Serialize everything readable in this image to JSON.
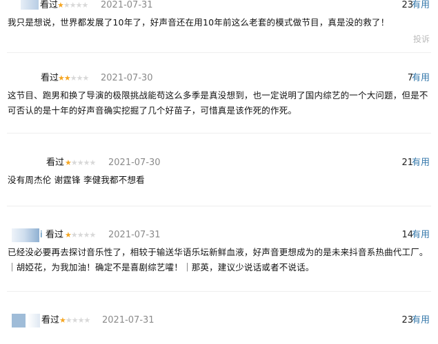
{
  "comments": [
    {
      "user": "看过",
      "seen": "",
      "rating": 1,
      "date": "2021-07-31",
      "votes": "23",
      "useful": "有用",
      "text": "我只是想说，世界都发展了10年了，好声音还在用10年前这么老套的模式做节目，真是没的救了！",
      "report": "投诉",
      "avatar_color": "#b8cde4"
    },
    {
      "user": "看过",
      "seen": "",
      "rating": 2,
      "date": "2021-07-30",
      "votes": "7",
      "useful": "有用",
      "text": "这节目、跑男和换了导演的极限挑战能苟这么多季是真没想到，也一定说明了国内综艺的一个大问题，但是不可否认的是十年的好声音确实挖掘了几个好苗子，可惜真是该作死的作死。",
      "avatar_color": "#ffffff"
    },
    {
      "user": "看过",
      "seen": "",
      "rating": 1,
      "date": "2021-07-30",
      "votes": "21",
      "useful": "有用",
      "text": "没有周杰伦 谢霆锋 李健我都不想看",
      "avatar_color": "#ffffff"
    },
    {
      "user": "i",
      "seen": "看过",
      "rating": 1,
      "date": "2021-07-31",
      "votes": "14",
      "useful": "有用",
      "text": "已经没必要再去探讨音乐性了，相较于输送华语乐坛新鲜血液，好声音更想成为的是未来抖音系热曲代工厂。｜胡婭花，为我加油！确定不是喜剧综艺嚯！｜那英，建议少说话或者不说话。",
      "avatar_color": "#a9c4de"
    },
    {
      "user": "看过",
      "seen": "",
      "rating": 1,
      "date": "2021-07-31",
      "votes": "23",
      "useful": "有用",
      "text": "",
      "avatar_color": "#9fbcd8"
    }
  ],
  "star_on_color": "#f5a623",
  "star_off_color": "#d8d8d8",
  "link_color": "#3377aa"
}
